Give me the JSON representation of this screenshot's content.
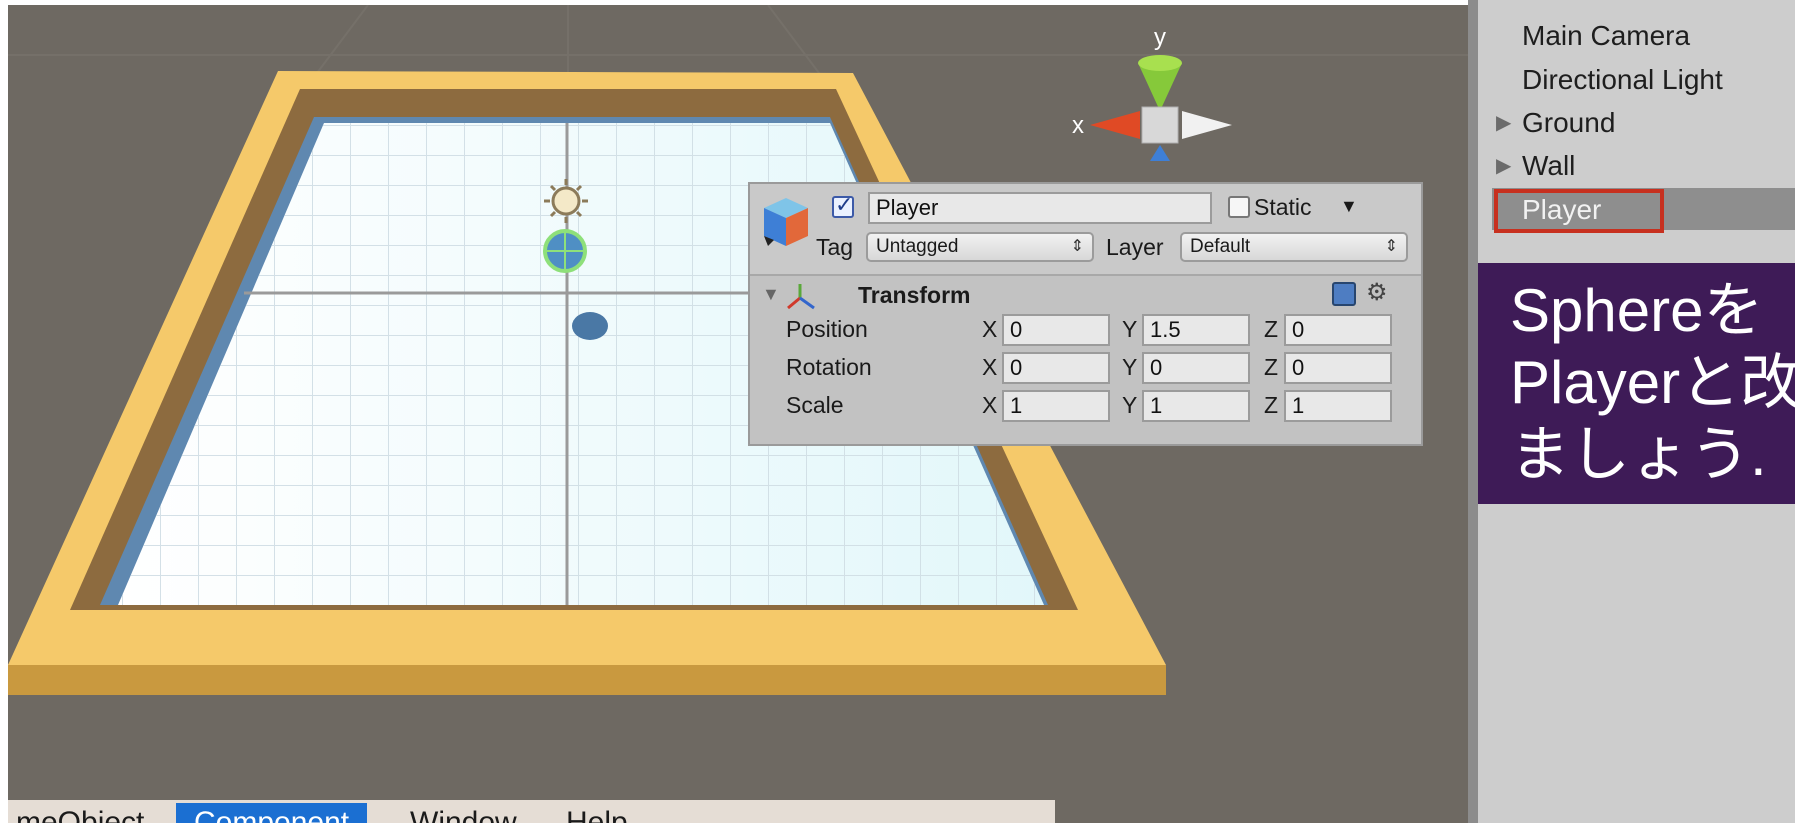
{
  "scene_gizmo": {
    "y_label": "y",
    "x_label": "x"
  },
  "inspector": {
    "object_name": "Player",
    "active": true,
    "static_label": "Static",
    "tag_label": "Tag",
    "tag_value": "Untagged",
    "layer_label": "Layer",
    "layer_value": "Default",
    "component_title": "Transform",
    "rows": [
      {
        "label": "Position",
        "x": "0",
        "y": "1.5",
        "z": "0"
      },
      {
        "label": "Rotation",
        "x": "0",
        "y": "0",
        "z": "0"
      },
      {
        "label": "Scale",
        "x": "1",
        "y": "1",
        "z": "1"
      }
    ],
    "axis_labels": {
      "x": "X",
      "y": "Y",
      "z": "Z"
    }
  },
  "hierarchy": {
    "items": [
      {
        "label": "Main Camera",
        "expandable": false
      },
      {
        "label": "Directional Light",
        "expandable": false
      },
      {
        "label": "Ground",
        "expandable": true
      },
      {
        "label": "Wall",
        "expandable": true
      }
    ],
    "selected": "Player",
    "highlight_color": "#c7301f"
  },
  "note": {
    "lines": [
      "Sphereを",
      "Playerと改",
      "ましょう."
    ]
  },
  "menubar": {
    "items": [
      "meObject",
      "Component",
      "Window",
      "Help"
    ],
    "active": "Component"
  },
  "colors": {
    "scene_bg": "#6e6962",
    "wall": "#f5c96a",
    "floor": "#ffffff",
    "note_bg": "#3e1b57",
    "menu_active": "#1b6fd2"
  }
}
